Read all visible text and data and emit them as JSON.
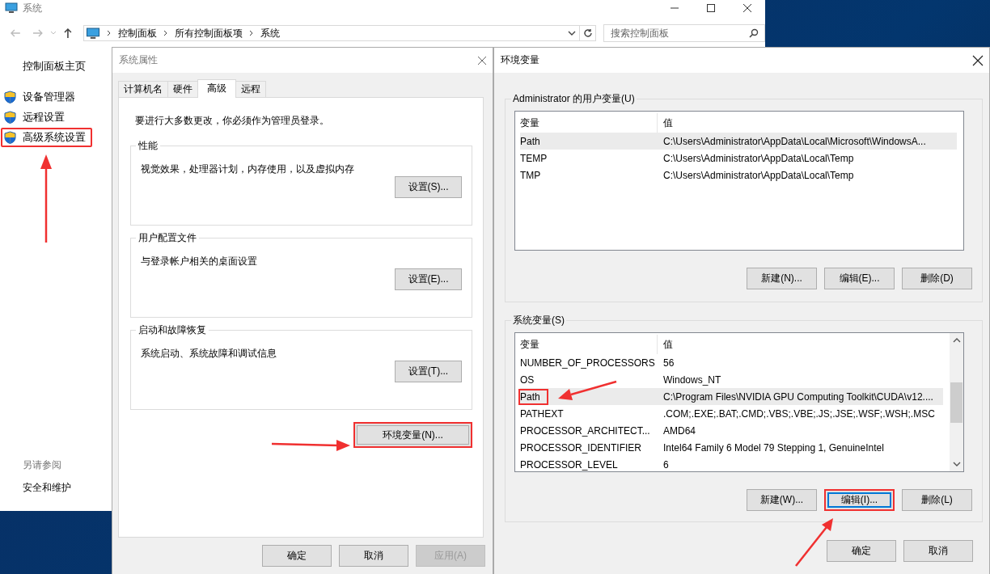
{
  "control_panel": {
    "title": "系统",
    "breadcrumb": [
      "控制面板",
      "所有控制面板项",
      "系统"
    ],
    "search": {
      "placeholder": "搜索控制面板"
    },
    "sidebar": {
      "home": "控制面板主页",
      "links": [
        {
          "label": "设备管理器",
          "highlighted": false
        },
        {
          "label": "远程设置",
          "highlighted": false
        },
        {
          "label": "高级系统设置",
          "highlighted": true
        }
      ],
      "see_also": {
        "heading": "另请参阅",
        "links": [
          "安全和维护"
        ]
      }
    }
  },
  "system_properties": {
    "title": "系统属性",
    "tabs": [
      {
        "label": "计算机名",
        "selected": false
      },
      {
        "label": "硬件",
        "selected": false
      },
      {
        "label": "高级",
        "selected": true
      },
      {
        "label": "远程",
        "selected": false
      }
    ],
    "notice": "要进行大多数更改，你必须作为管理员登录。",
    "groups": [
      {
        "title": "性能",
        "description": "视觉效果，处理器计划，内存使用，以及虚拟内存",
        "button": "设置(S)..."
      },
      {
        "title": "用户配置文件",
        "description": "与登录帐户相关的桌面设置",
        "button": "设置(E)..."
      },
      {
        "title": "启动和故障恢复",
        "description": "系统启动、系统故障和调试信息",
        "button": "设置(T)..."
      }
    ],
    "env_button": {
      "label": "环境变量(N)...",
      "highlighted": true
    },
    "buttons": [
      {
        "label": "确定",
        "disabled": false
      },
      {
        "label": "取消",
        "disabled": false
      },
      {
        "label": "应用(A)",
        "disabled": true
      }
    ]
  },
  "environment_variables": {
    "title": "环境变量",
    "user_vars": {
      "heading": "Administrator 的用户变量(U)",
      "columns": [
        "变量",
        "值"
      ],
      "rows": [
        {
          "name": "Path",
          "value": "C:\\Users\\Administrator\\AppData\\Local\\Microsoft\\WindowsA...",
          "selected": true,
          "highlighted": false
        },
        {
          "name": "TEMP",
          "value": "C:\\Users\\Administrator\\AppData\\Local\\Temp",
          "selected": false,
          "highlighted": false
        },
        {
          "name": "TMP",
          "value": "C:\\Users\\Administrator\\AppData\\Local\\Temp",
          "selected": false,
          "highlighted": false
        }
      ],
      "buttons": [
        {
          "label": "新建(N)...",
          "highlighted": false
        },
        {
          "label": "编辑(E)...",
          "highlighted": false
        },
        {
          "label": "删除(D)",
          "highlighted": false
        }
      ]
    },
    "system_vars": {
      "heading": "系统变量(S)",
      "columns": [
        "变量",
        "值"
      ],
      "rows": [
        {
          "name": "NUMBER_OF_PROCESSORS",
          "value": "56",
          "selected": false,
          "highlighted": false
        },
        {
          "name": "OS",
          "value": "Windows_NT",
          "selected": false,
          "highlighted": false
        },
        {
          "name": "Path",
          "value": "C:\\Program Files\\NVIDIA GPU Computing Toolkit\\CUDA\\v12....",
          "selected": true,
          "highlighted": true
        },
        {
          "name": "PATHEXT",
          "value": ".COM;.EXE;.BAT;.CMD;.VBS;.VBE;.JS;.JSE;.WSF;.WSH;.MSC",
          "selected": false,
          "highlighted": false
        },
        {
          "name": "PROCESSOR_ARCHITECT...",
          "value": "AMD64",
          "selected": false,
          "highlighted": false
        },
        {
          "name": "PROCESSOR_IDENTIFIER",
          "value": "Intel64 Family 6 Model 79 Stepping 1, GenuineIntel",
          "selected": false,
          "highlighted": false
        },
        {
          "name": "PROCESSOR_LEVEL",
          "value": "6",
          "selected": false,
          "highlighted": false
        }
      ],
      "buttons": [
        {
          "label": "新建(W)...",
          "highlighted": false
        },
        {
          "label": "编辑(I)...",
          "highlighted": true
        },
        {
          "label": "删除(L)",
          "highlighted": false
        }
      ]
    },
    "buttons": [
      {
        "label": "确定"
      },
      {
        "label": "取消"
      }
    ]
  }
}
